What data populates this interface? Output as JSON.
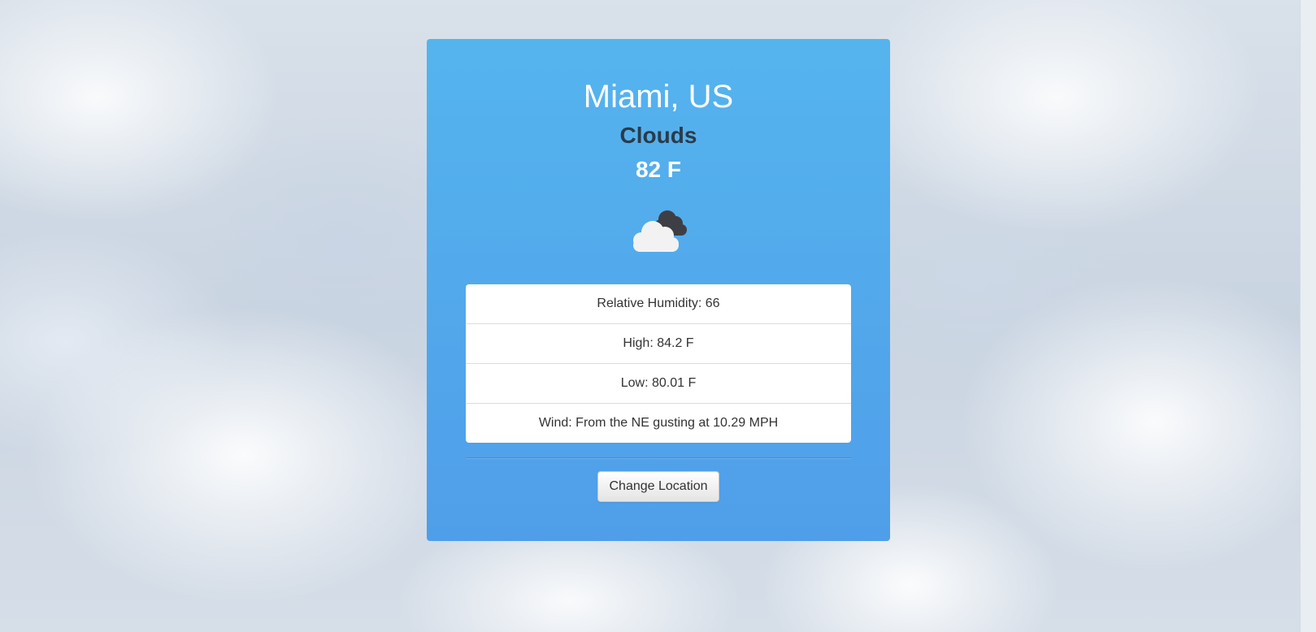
{
  "weather": {
    "location": "Miami, US",
    "condition": "Clouds",
    "temperature": "82 F",
    "icon": "clouds-icon",
    "details": [
      {
        "label": "Relative Humidity: 66"
      },
      {
        "label": "High: 84.2 F"
      },
      {
        "label": "Low: 80.01 F"
      },
      {
        "label": "Wind: From the NE gusting at 10.29 MPH"
      }
    ]
  },
  "actions": {
    "change_location_label": "Change Location"
  },
  "colors": {
    "card_top": "#55b4ee",
    "card_bottom": "#4f9ee9",
    "condition_text": "#2b3b4a",
    "white": "#ffffff"
  }
}
